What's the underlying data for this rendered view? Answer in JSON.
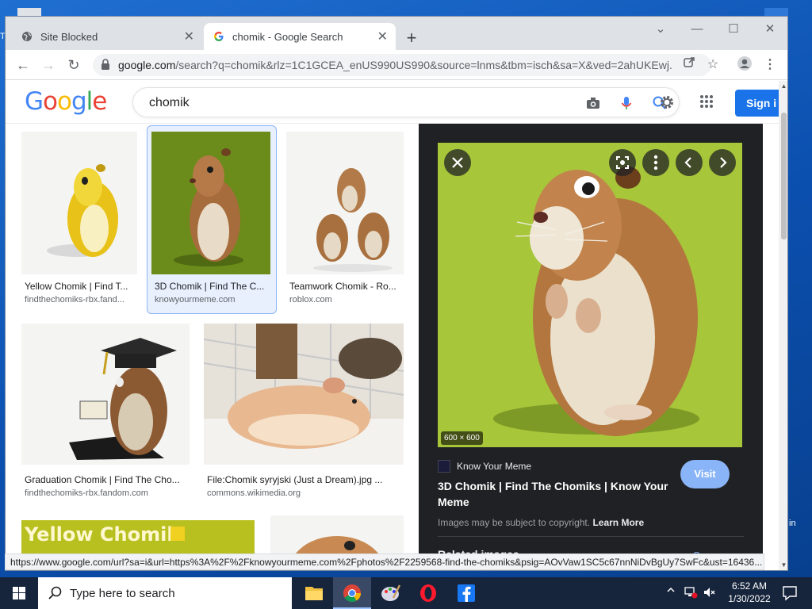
{
  "browser": {
    "tabs": [
      {
        "label": "Site Blocked",
        "active": false
      },
      {
        "label": "chomik - Google Search",
        "active": true
      }
    ],
    "url_host": "google.com",
    "url_rest": "/search?q=chomik&rlz=1C1GCEA_enUS990US990&source=lnms&tbm=isch&sa=X&ved=2ahUKEwj...",
    "status_url": "https://www.google.com/url?sa=i&url=https%3A%2F%2Fknowyourmeme.com%2Fphotos%2F2259568-find-the-chomiks&psig=AOvVaw1SC5c67nnNiDvBgUy7SwFc&ust=16436..."
  },
  "google": {
    "logo": [
      "G",
      "o",
      "o",
      "g",
      "l",
      "e"
    ],
    "logo_colors": [
      "#4285f4",
      "#ea4335",
      "#fbbc05",
      "#4285f4",
      "#34a853",
      "#ea4335"
    ],
    "query": "chomik",
    "signin_label": "Sign i"
  },
  "results": [
    {
      "title": "Yellow Chomik | Find T...",
      "source": "findthechomiks-rbx.fand...",
      "img": "yellow-hamster"
    },
    {
      "title": "3D Chomik | Find The C...",
      "source": "knowyourmeme.com",
      "img": "3d-hamster",
      "selected": true
    },
    {
      "title": "Teamwork Chomik - Ro...",
      "source": "roblox.com",
      "img": "teamwork-hamsters"
    },
    {
      "title": "Graduation Chomik | Find The Cho...",
      "source": "findthechomiks-rbx.fandom.com",
      "img": "graduation-hamster"
    },
    {
      "title": "File:Chomik syryjski (Just a Dream).jpg ...",
      "source": "commons.wikimedia.org",
      "img": "real-hamster"
    },
    {
      "title": "",
      "source": "",
      "banner": "Yellow Chomik",
      "img": "yellow-banner"
    },
    {
      "title": "",
      "source": "",
      "img": "hamster-partial"
    }
  ],
  "preview": {
    "dimensions": "600 × 600",
    "site_name": "Know Your Meme",
    "title": "3D Chomik | Find The Chomiks | Know Your Meme",
    "copyright": "Images may be subject to copyright.",
    "learn_more": "Learn More",
    "visit_label": "Visit",
    "related_label": "Related images",
    "see_more_label": "See more"
  },
  "taskbar": {
    "search_placeholder": "Type here to search",
    "time": "6:52 AM",
    "date": "1/30/2022"
  },
  "desktop": {
    "frag_left": "T",
    "frag_right": "in"
  }
}
